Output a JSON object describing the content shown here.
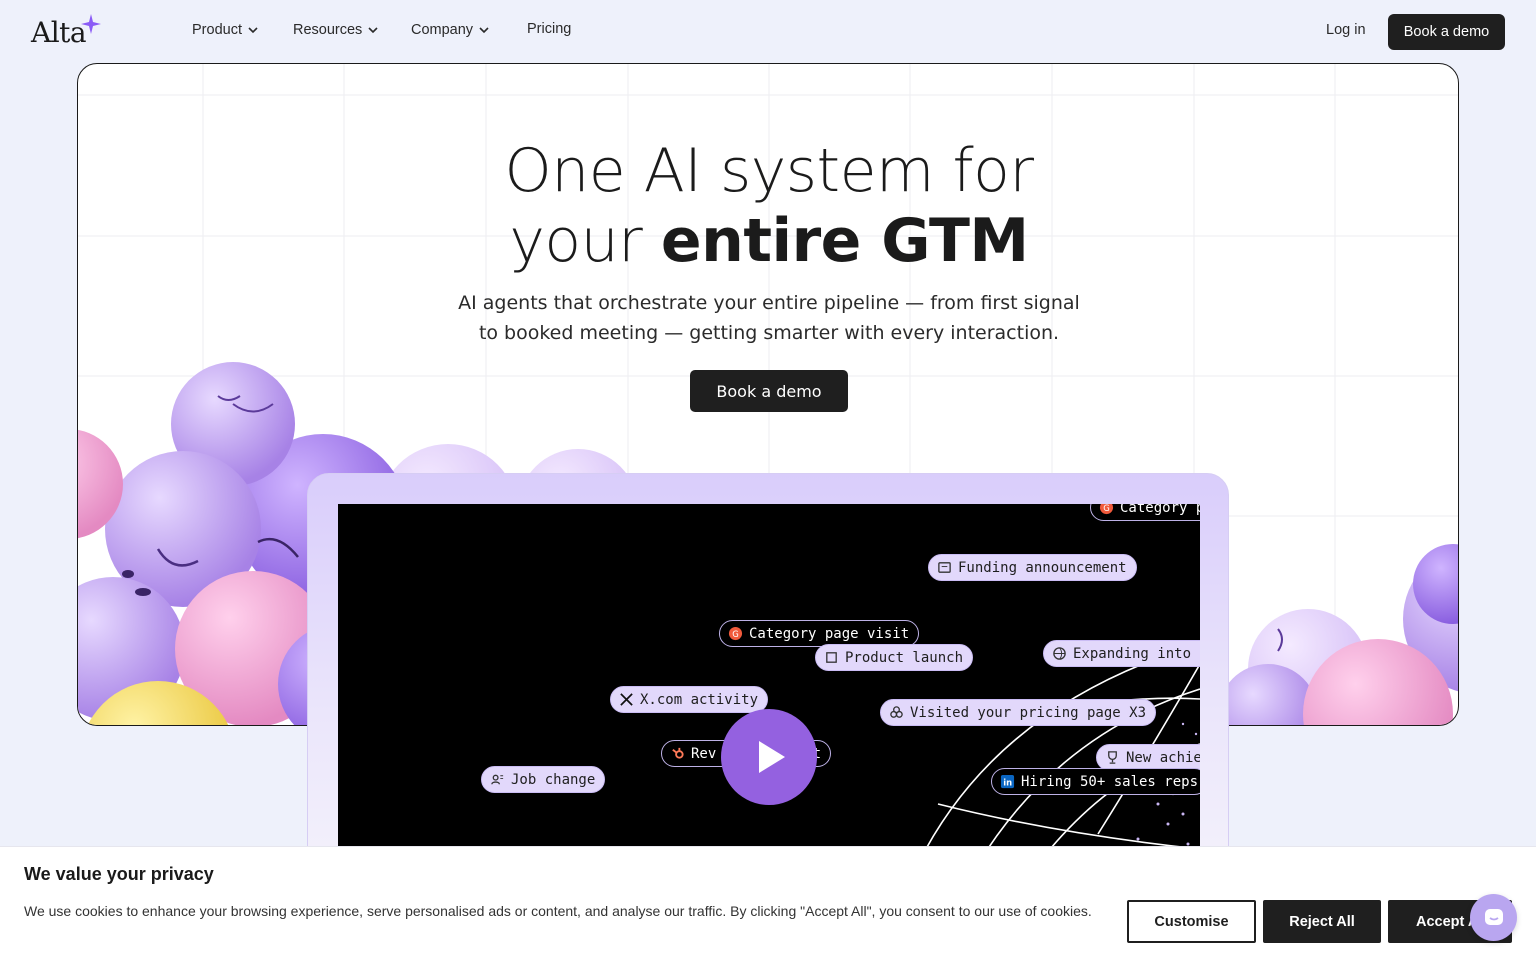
{
  "nav": {
    "logo": "Alta",
    "items": [
      {
        "label": "Product",
        "has_dropdown": true
      },
      {
        "label": "Resources",
        "has_dropdown": true
      },
      {
        "label": "Company",
        "has_dropdown": true
      },
      {
        "label": "Pricing",
        "has_dropdown": false
      }
    ],
    "login": "Log in",
    "demo": "Book a demo"
  },
  "hero": {
    "headline_line1": "One AI system for",
    "headline_line2_light": "your",
    "headline_line2_bold": "entire GTM",
    "sub_line1": "AI agents that orchestrate your entire pipeline — from first signal",
    "sub_line2": "to booked meeting — getting smarter with every interaction.",
    "cta": "Book a demo"
  },
  "video": {
    "signals": [
      {
        "label": "Category p",
        "icon": "g2-icon",
        "style": "dark"
      },
      {
        "label": "Funding announcement",
        "icon": "news-icon",
        "style": "light"
      },
      {
        "label": "Category page visit",
        "icon": "g2-icon",
        "style": "dark"
      },
      {
        "label": "Product launch",
        "icon": "launch-icon",
        "style": "light"
      },
      {
        "label": "Expanding into EM",
        "icon": "globe-icon",
        "style": "light"
      },
      {
        "label": "X.com activity",
        "icon": "x-icon",
        "style": "light"
      },
      {
        "label": "Visited your pricing page X3",
        "icon": "pricing-icon",
        "style": "light"
      },
      {
        "label": "Rev",
        "icon": "hubspot-icon",
        "style": "dark"
      },
      {
        "label": "t",
        "icon": "",
        "style": "dark"
      },
      {
        "label": "New achiev",
        "icon": "trophy-icon",
        "style": "light"
      },
      {
        "label": "Job change",
        "icon": "person-icon",
        "style": "light"
      },
      {
        "label": "Hiring 50+ sales reps",
        "icon": "linkedin-icon",
        "style": "dark"
      }
    ],
    "play_icon": "play-icon"
  },
  "cookie": {
    "title": "We value your privacy",
    "text": "We use cookies to enhance your browsing experience, serve personalised ads or content, and analyse our traffic. By clicking \"Accept All\", you consent to our use of cookies.",
    "customise": "Customise",
    "reject": "Reject All",
    "accept": "Accept All"
  },
  "colors": {
    "page_bg": "#eef1fb",
    "accent_purple": "#9461e0",
    "dark_button": "#1f1f1f"
  }
}
